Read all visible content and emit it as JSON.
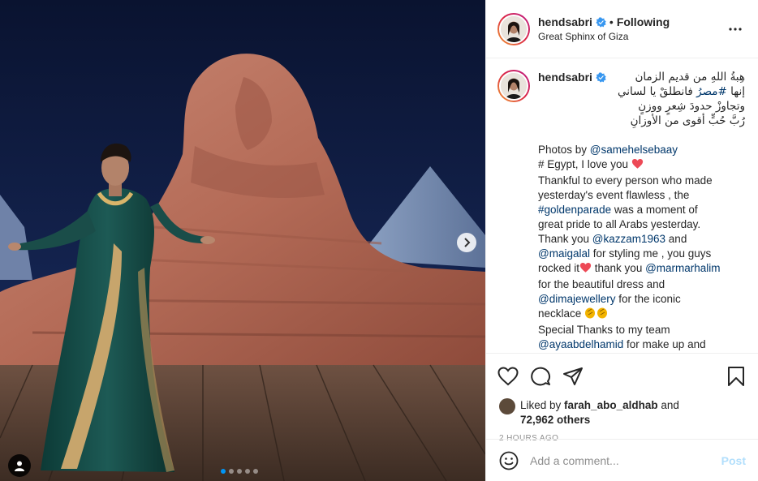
{
  "header": {
    "username": "hendsabri",
    "separator": "•",
    "follow_status": "Following",
    "location": "Great Sphinx of Giza"
  },
  "caption": {
    "username": "hendsabri",
    "arabic_lines": [
      "هِبةُ اللهِ من قديم الزمان",
      "إنها #مصرُ فانطلقْ يا لساني",
      "وتجاوزْ حدودَ شِعرٍ ووزنٍ",
      "رُبَّ حُبٍّ أقوى من الأوزانِ"
    ],
    "en_lines": [
      {
        "parts": [
          {
            "t": "Photos by "
          },
          {
            "t": "@samehelsebaay",
            "link": true
          }
        ]
      },
      {
        "parts": [
          {
            "t": "# Egypt, I love you "
          },
          {
            "heart": true
          }
        ]
      },
      {
        "parts": [
          {
            "t": "Thankful to every person who made"
          }
        ]
      },
      {
        "parts": [
          {
            "t": "yesterday's event flawless , the"
          }
        ]
      },
      {
        "parts": [
          {
            "t": "#goldenparade",
            "link": true
          },
          {
            "t": " was a moment of"
          }
        ]
      },
      {
        "parts": [
          {
            "t": "great pride to all Arabs yesterday."
          }
        ]
      },
      {
        "parts": [
          {
            "t": "Thank you "
          },
          {
            "t": "@kazzam1963",
            "link": true
          },
          {
            "t": " and"
          }
        ]
      },
      {
        "parts": [
          {
            "t": "@maigalal",
            "link": true
          },
          {
            "t": " for styling me , you guys"
          }
        ]
      },
      {
        "parts": [
          {
            "t": "rocked it"
          },
          {
            "heart": true
          },
          {
            "t": " thank you "
          },
          {
            "t": "@marmarhalim",
            "link": true
          }
        ]
      },
      {
        "parts": [
          {
            "t": "for the beautiful dress and"
          }
        ]
      },
      {
        "parts": [
          {
            "t": "@dimajewellery",
            "link": true
          },
          {
            "t": " for the iconic"
          }
        ]
      },
      {
        "parts": [
          {
            "t": "necklace "
          },
          {
            "clap": true
          }
        ]
      },
      {
        "parts": [
          {
            "t": "Special Thanks to my team"
          }
        ]
      },
      {
        "parts": [
          {
            "t": "@ayaabdelhamid",
            "link": true
          },
          {
            "t": " for make up and"
          }
        ]
      }
    ]
  },
  "likes": {
    "prefix": "Liked by ",
    "liker": "farah_abo_aldhab",
    "and": " and",
    "count": "72,962 others"
  },
  "timestamp": "2 HOURS AGO",
  "comment_box": {
    "placeholder": "Add a comment...",
    "post_label": "Post"
  },
  "carousel": {
    "total": 5,
    "active": 0
  },
  "colors": {
    "link": "#00376b",
    "verified": "#3897f0",
    "heart": "#ed4956",
    "post_disabled": "#b2dffc",
    "carousel_active": "#0095f6"
  },
  "icons": [
    "verified-badge-icon",
    "more-options-icon",
    "heart-icon",
    "comment-icon",
    "share-icon",
    "bookmark-icon",
    "emoji-icon",
    "next-arrow-icon",
    "tag-user-icon"
  ]
}
